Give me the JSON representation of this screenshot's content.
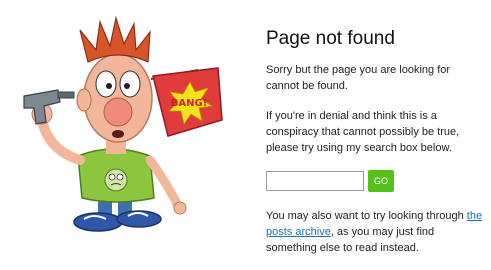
{
  "page": {
    "title": "Page not found",
    "intro": "Sorry but the page you are looking for cannot be found.",
    "denial": "If you're in denial and think this is a conspiracy that cannot possibly be true, please try using my search box below.",
    "search": {
      "placeholder": "",
      "value": "",
      "button_label": "GO"
    },
    "also_before": "You may also want to try looking through ",
    "archive_link": "the posts archive",
    "also_after": ", as you may just find something else to read instead."
  },
  "illustration": {
    "flag_text": "BANG!",
    "colors": {
      "hair": "#d8552a",
      "skin": "#f2b79a",
      "shirt": "#8cc63f",
      "flag": "#e23b3b",
      "burst": "#f4e21c",
      "gun": "#7d8792",
      "pants": "#3c6fb4"
    }
  }
}
